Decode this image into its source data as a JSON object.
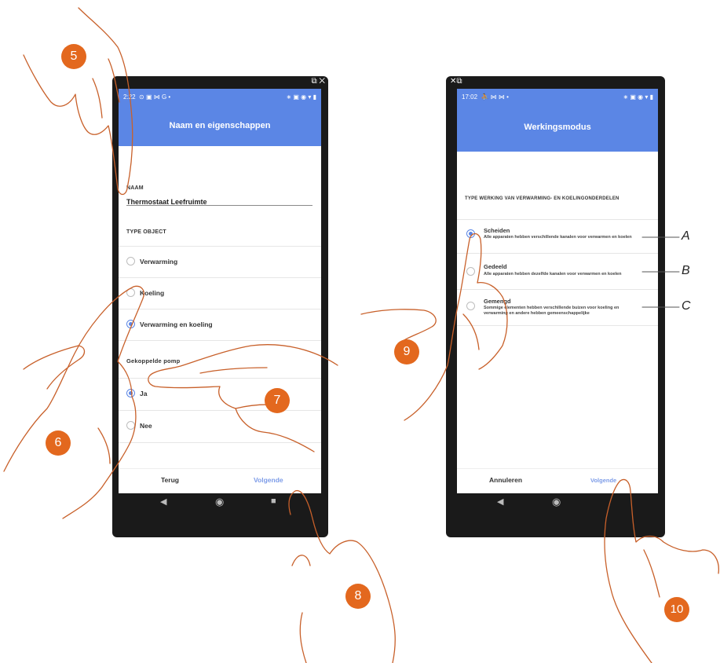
{
  "left_screen": {
    "status_time": "2:22",
    "status_icons": "⊙ ▣ ⋈ G •",
    "status_right": "∗ ▣ ◉ ▾ ▮",
    "title": "Naam en eigenschappen",
    "name_label": "NAAM",
    "name_value": "Thermostaat Leefruimte",
    "type_label": "TYPE OBJECT",
    "type_options": [
      "Verwarming",
      "Koeling",
      "Verwarming en koeling"
    ],
    "pump_label": "Gekoppelde pomp",
    "pump_options": [
      "Ja",
      "Nee"
    ],
    "back_label": "Terug",
    "next_label": "Volgende"
  },
  "right_screen": {
    "status_time": "17:02",
    "status_icons": "⛹ ⋈ ⋈ •",
    "status_right": "∗ ▣ ◉ ▾ ▮",
    "title": "Werkingsmodus",
    "section_label": "TYPE WERKING VAN VERWARMING- EN KOELINGONDERDELEN",
    "options": [
      {
        "title": "Scheiden",
        "desc": "Alle apparaten hebben verschillende kanalen voor verwarmen en koelen"
      },
      {
        "title": "Gedeeld",
        "desc": "Alle apparaten hebben dezelfde kanalen voor verwarmen en koelen"
      },
      {
        "title": "Gemengd",
        "desc": "Sommige elementen hebben verschillende buizen voor koeling en verwarming en andere hebben gemeenschappelijke"
      }
    ],
    "cancel_label": "Annuleren",
    "next_label": "Volgende"
  },
  "callouts": [
    "5",
    "6",
    "7",
    "8",
    "9",
    "10"
  ],
  "letters": [
    "A",
    "B",
    "C"
  ],
  "colors": {
    "accent": "#5b86e5",
    "callout": "#e3681e",
    "hand_stroke": "#c8602a"
  }
}
